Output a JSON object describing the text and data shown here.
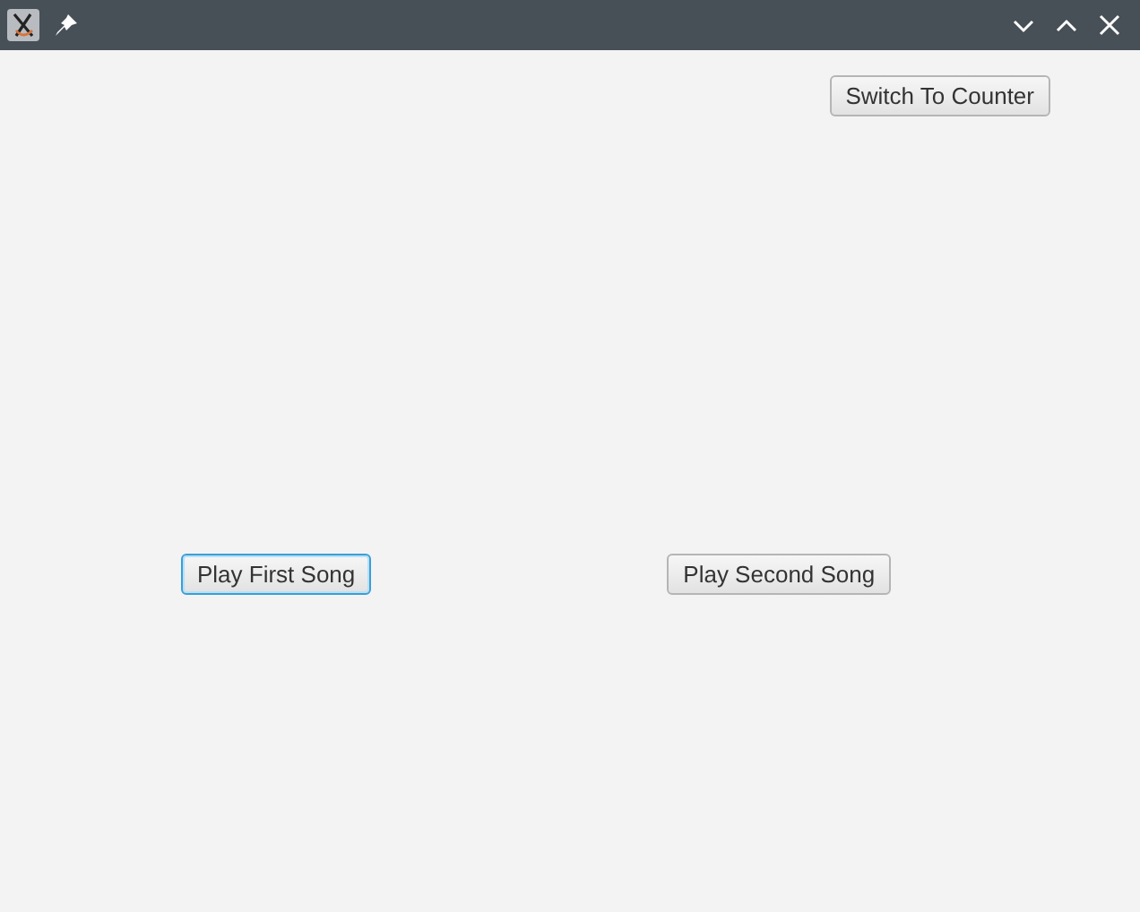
{
  "window": {
    "controls": [
      {
        "kind": "minimize"
      },
      {
        "kind": "maximize"
      },
      {
        "kind": "close"
      }
    ]
  },
  "top_button": {
    "label": "Switch To Counter",
    "focused": false
  },
  "buttons": [
    {
      "label": "Play First Song",
      "focused": true
    },
    {
      "label": "Play Second Song",
      "focused": false
    }
  ]
}
